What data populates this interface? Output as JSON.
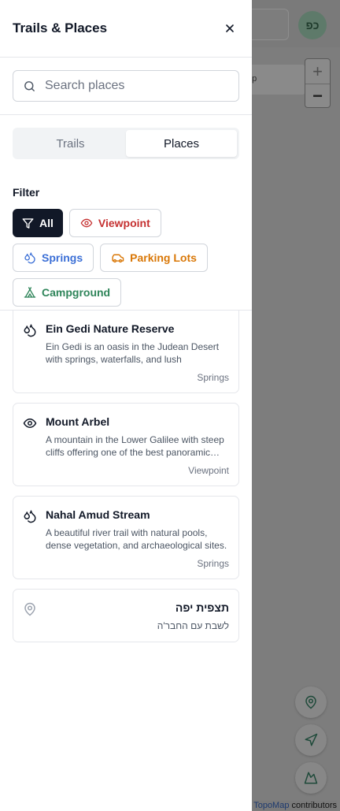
{
  "panel": {
    "title": "Trails & Places",
    "search_placeholder": "Search places",
    "tabs": [
      {
        "label": "Trails",
        "active": false
      },
      {
        "label": "Places",
        "active": true
      }
    ],
    "filter_label": "Filter",
    "filters": [
      {
        "label": "All",
        "icon": "funnel-icon",
        "active": true
      },
      {
        "label": "Viewpoint",
        "icon": "eye-icon",
        "color": "#c53030"
      },
      {
        "label": "Springs",
        "icon": "droplets-icon",
        "color": "#3b6fd6"
      },
      {
        "label": "Parking Lots",
        "icon": "car-icon",
        "color": "#d97706"
      },
      {
        "label": "Campground",
        "icon": "tent-icon",
        "color": "#2f855a"
      }
    ],
    "places": [
      {
        "title": "Ein Gedi Nature Reserve",
        "description": "Ein Gedi is an oasis in the Judean Desert with springs, waterfalls, and lush vegetation.",
        "type": "Springs",
        "icon": "droplets-icon"
      },
      {
        "title": "Mount Arbel",
        "description": "A mountain in the Lower Galilee with steep cliffs offering one of the best panoramic…",
        "type": "Viewpoint",
        "icon": "eye-icon"
      },
      {
        "title": "Nahal Amud Stream",
        "description": "A beautiful river trail with natural pools, dense vegetation, and archaeological sites.",
        "type": "Springs",
        "icon": "droplets-icon"
      },
      {
        "title": "תצפית יפה",
        "description": "לשבת עם החבר'ה",
        "type": "",
        "icon": "map-pin-icon"
      }
    ]
  },
  "map": {
    "avatar_initials": "כפ",
    "chip_text": "ap",
    "zoom_in": "+",
    "zoom_out": "−",
    "attribution_link": "TopoMap",
    "attribution_text": " contributors"
  }
}
